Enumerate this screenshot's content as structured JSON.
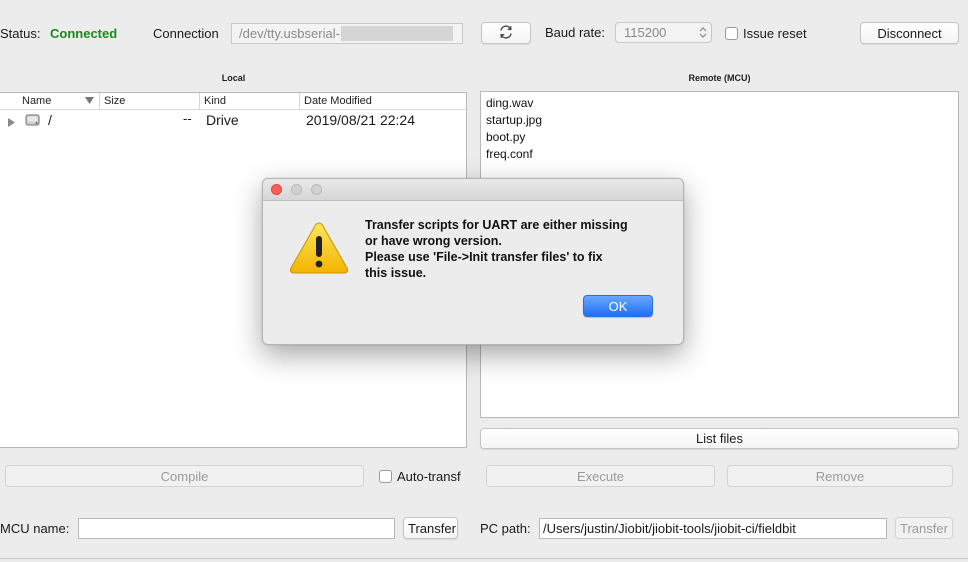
{
  "toolbar": {
    "status_label": "Status:",
    "status_value": "Connected",
    "status_color": "#1a8a1a",
    "connection_label": "Connection",
    "connection_value": "/dev/tty.usbserial-",
    "refresh_icon": "refresh-icon",
    "baud_label": "Baud rate:",
    "baud_value": "115200",
    "issue_reset_label": "Issue reset",
    "issue_reset_checked": false,
    "disconnect_label": "Disconnect"
  },
  "local": {
    "title": "Local",
    "columns": [
      "Name",
      "Size",
      "Kind",
      "Date Modified"
    ],
    "rows": [
      {
        "name": "/",
        "size": "--",
        "kind": "Drive",
        "date": "2019/08/21 22:24"
      }
    ]
  },
  "remote": {
    "title": "Remote (MCU)",
    "files": [
      "ding.wav",
      "startup.jpg",
      "boot.py",
      "freq.conf"
    ],
    "list_files_label": "List files"
  },
  "actions": {
    "compile_label": "Compile",
    "auto_transfer_label": "Auto-transf",
    "execute_label": "Execute",
    "remove_label": "Remove"
  },
  "bottom": {
    "mcu_name_label": "MCU name:",
    "mcu_name_value": "",
    "transfer_left_label": "Transfer",
    "pc_path_label": "PC path:",
    "pc_path_value": "/Users/justin/Jiobit/jiobit-tools/jiobit-ci/fieldbit",
    "transfer_right_label": "Transfer"
  },
  "dialog": {
    "message_lines": [
      "Transfer scripts for UART are either missing",
      "or have wrong version.",
      "Please use 'File->Init transfer files' to fix",
      "this issue."
    ],
    "ok_label": "OK",
    "warning_icon": "warning-icon"
  }
}
